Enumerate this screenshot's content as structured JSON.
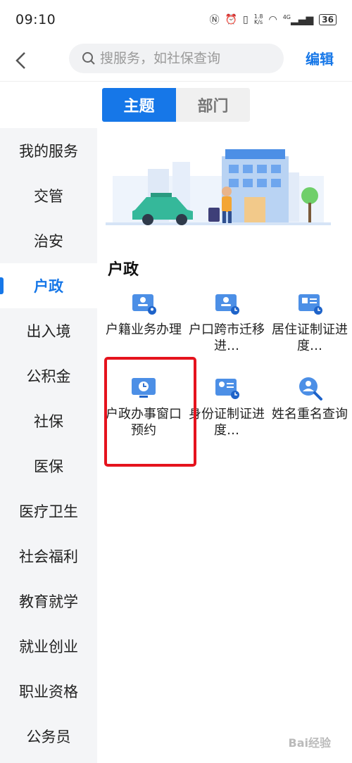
{
  "status": {
    "time": "09:10",
    "speed_top": "1.8",
    "speed_bottom": "K/s",
    "network": "4G",
    "battery": "36"
  },
  "header": {
    "search_placeholder": "搜服务，如社保查询",
    "edit_label": "编辑"
  },
  "tabs": [
    {
      "label": "主题"
    },
    {
      "label": "部门"
    }
  ],
  "sidebar": {
    "items": [
      {
        "label": "我的服务"
      },
      {
        "label": "交管"
      },
      {
        "label": "治安"
      },
      {
        "label": "户政"
      },
      {
        "label": "出入境"
      },
      {
        "label": "公积金"
      },
      {
        "label": "社保"
      },
      {
        "label": "医保"
      },
      {
        "label": "医疗卫生"
      },
      {
        "label": "社会福利"
      },
      {
        "label": "教育就学"
      },
      {
        "label": "就业创业"
      },
      {
        "label": "职业资格"
      },
      {
        "label": "公务员"
      }
    ]
  },
  "section": {
    "title": "户政",
    "services": [
      {
        "label": "户籍业务办理",
        "icon": "id-card-user-icon"
      },
      {
        "label": "户口跨市迁移进…",
        "icon": "id-card-clock-icon"
      },
      {
        "label": "居住证制证进度…",
        "icon": "card-clock-icon"
      },
      {
        "label": "户政办事窗口预约",
        "icon": "monitor-clock-icon"
      },
      {
        "label": "身份证制证进度…",
        "icon": "id-card-clock-icon"
      },
      {
        "label": "姓名重名查询",
        "icon": "user-search-icon"
      }
    ]
  },
  "colors": {
    "accent": "#1677e8",
    "highlight": "#e5131d",
    "sidebar_bg": "#f4f5f7"
  },
  "watermark": "Bai经验"
}
